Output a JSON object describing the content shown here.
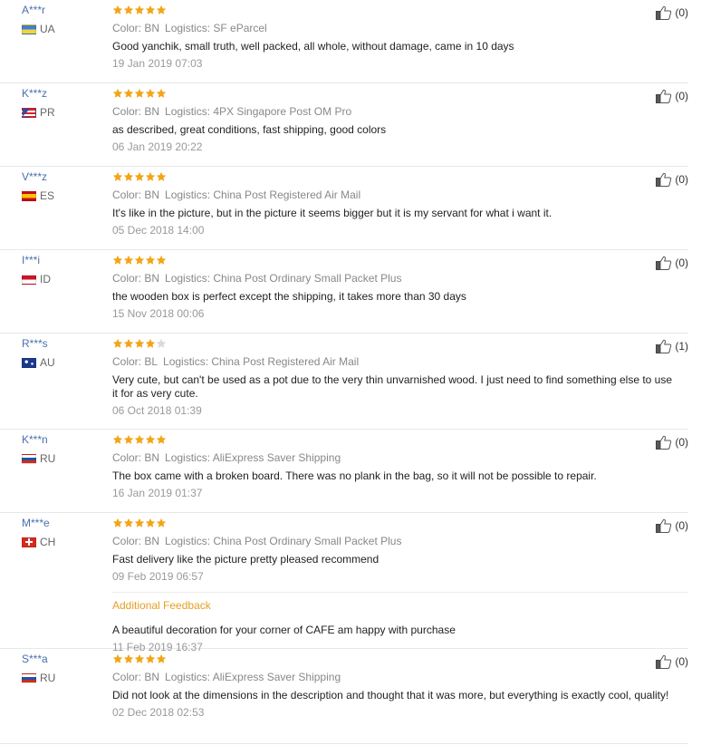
{
  "reviews": [
    {
      "user": "A***r",
      "country": "UA",
      "rating": 5,
      "color": "Color: BN",
      "logistics": "Logistics: SF eParcel",
      "text": "Good yanchik, small truth, well packed, all whole, without damage, came in 10 days",
      "date": "19 Jan 2019 07:03",
      "helpful": "(0)",
      "flag": [
        "#3d7fd6",
        "#f4d23a"
      ]
    },
    {
      "user": "K***z",
      "country": "PR",
      "rating": 5,
      "color": "Color: BN",
      "logistics": "Logistics: 4PX Singapore Post OM Pro",
      "text": "as described, great conditions, fast shipping, good colors",
      "date": "06 Jan 2019 20:22",
      "helpful": "(0)",
      "flag": [
        "#d22",
        "#fff",
        "#2a4fa8"
      ]
    },
    {
      "user": "V***z",
      "country": "ES",
      "rating": 5,
      "color": "Color: BN",
      "logistics": "Logistics: China Post Registered Air Mail",
      "text": "It's like in the picture, but in the picture it seems bigger but it is my servant for what i want it.",
      "date": "05 Dec 2018 14:00",
      "helpful": "(0)",
      "flag": [
        "#c60b1e",
        "#ffc400"
      ]
    },
    {
      "user": "I***i",
      "country": "ID",
      "rating": 5,
      "color": "Color: BN",
      "logistics": "Logistics: China Post Ordinary Small Packet Plus",
      "text": "the wooden box is perfect except the shipping, it takes more than 30 days",
      "date": "15 Nov 2018 00:06",
      "helpful": "(0)",
      "flag": [
        "#ce1126",
        "#ffffff"
      ]
    },
    {
      "user": "R***s",
      "country": "AU",
      "rating": 4,
      "color": "Color: BL",
      "logistics": "Logistics: China Post Registered Air Mail",
      "text": "Very cute, but can't be used as a pot due to the very thin unvarnished wood. I just need to find something else to use it for as very cute.",
      "date": "06 Oct 2018 01:39",
      "helpful": "(1)",
      "flag": [
        "#1b3a8c",
        "#fff"
      ]
    },
    {
      "user": "K***n",
      "country": "RU",
      "rating": 5,
      "color": "Color: BN",
      "logistics": "Logistics: AliExpress Saver Shipping",
      "text": "The box came with a broken board. There was no plank in the bag, so it will not be possible to repair.",
      "date": "16 Jan 2019 01:37",
      "helpful": "(0)",
      "flag": [
        "#ffffff",
        "#1c57a5",
        "#d52b1e"
      ]
    },
    {
      "user": "M***e",
      "country": "CH",
      "rating": 5,
      "color": "Color: BN",
      "logistics": "Logistics: China Post Ordinary Small Packet Plus",
      "text": "Fast delivery like the picture pretty pleased recommend",
      "date": "09 Feb 2019 06:57",
      "helpful": "(0)",
      "flag": [
        "#d52b1e",
        "#ffffff"
      ],
      "additional": {
        "title": "Additional Feedback",
        "text": "A beautiful decoration for your corner of CAFE am happy with purchase",
        "date": "11 Feb 2019 16:37"
      }
    },
    {
      "user": "S***a",
      "country": "RU",
      "rating": 5,
      "color": "Color: BN",
      "logistics": "Logistics: AliExpress Saver Shipping",
      "text": "Did not look at the dimensions in the description and thought that it was more, but everything is exactly cool, quality!",
      "date": "02 Dec 2018 02:53",
      "helpful": "(0)",
      "flag": [
        "#ffffff",
        "#1c57a5",
        "#d52b1e"
      ]
    }
  ],
  "colors": {
    "star_on": "#f2a516",
    "star_off": "#d9d9d9",
    "username": "#4a6fae",
    "additional_title": "#e5a023"
  },
  "icons": {
    "rating": "star-icon",
    "helpful": "thumbs-up-icon"
  }
}
